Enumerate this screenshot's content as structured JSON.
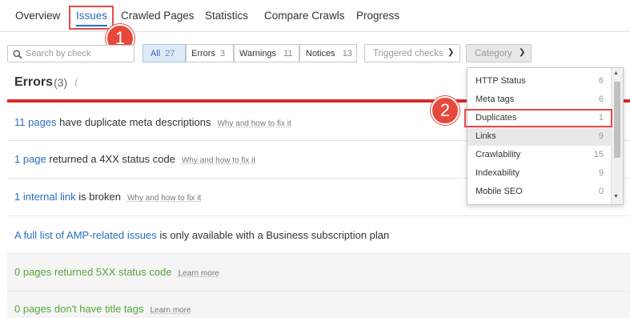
{
  "tabs": [
    {
      "label": "Overview"
    },
    {
      "label": "Issues"
    },
    {
      "label": "Crawled Pages"
    },
    {
      "label": "Statistics"
    },
    {
      "label": "Compare Crawls"
    },
    {
      "label": "Progress"
    }
  ],
  "search": {
    "placeholder": "Search by check",
    "value": ""
  },
  "filters": {
    "all": {
      "label": "All",
      "count": "27"
    },
    "errors": {
      "label": "Errors",
      "count": "3"
    },
    "warnings": {
      "label": "Warnings",
      "count": "11"
    },
    "notices": {
      "label": "Notices",
      "count": "13"
    }
  },
  "triggered_checks": {
    "label": "Triggered checks"
  },
  "category": {
    "label": "Category"
  },
  "errors_section": {
    "title": "Errors",
    "count": "(3)"
  },
  "rows": [
    {
      "link": "11 pages",
      "text": " have duplicate meta descriptions",
      "help": "Why and how to fix it"
    },
    {
      "link": "1 page",
      "text": " returned a 4XX status code",
      "help": "Why and how to fix it"
    },
    {
      "link": "1 internal link",
      "text": " is broken",
      "help": "Why and how to fix it"
    },
    {
      "link": "A full list of AMP-related issues",
      "text": " is only available with a Business subscription plan",
      "help": ""
    },
    {
      "link": "",
      "text": "0 pages returned 5XX status code",
      "help": "Learn more"
    },
    {
      "link": "",
      "text": "0 pages don't have title tags",
      "help": "Learn more"
    }
  ],
  "category_menu": [
    {
      "label": "HTTP Status",
      "count": "6"
    },
    {
      "label": "Meta tags",
      "count": "6"
    },
    {
      "label": "Duplicates",
      "count": "1"
    },
    {
      "label": "Links",
      "count": "9"
    },
    {
      "label": "Crawlability",
      "count": "15"
    },
    {
      "label": "Indexability",
      "count": "9"
    },
    {
      "label": "Mobile SEO",
      "count": "0"
    }
  ],
  "steps": [
    "1",
    "2"
  ],
  "colors": {
    "accent": "#2a6ebb",
    "error_bar": "#d72b2b",
    "highlight": "#e84a4a",
    "ok_green": "#5aa63c"
  }
}
